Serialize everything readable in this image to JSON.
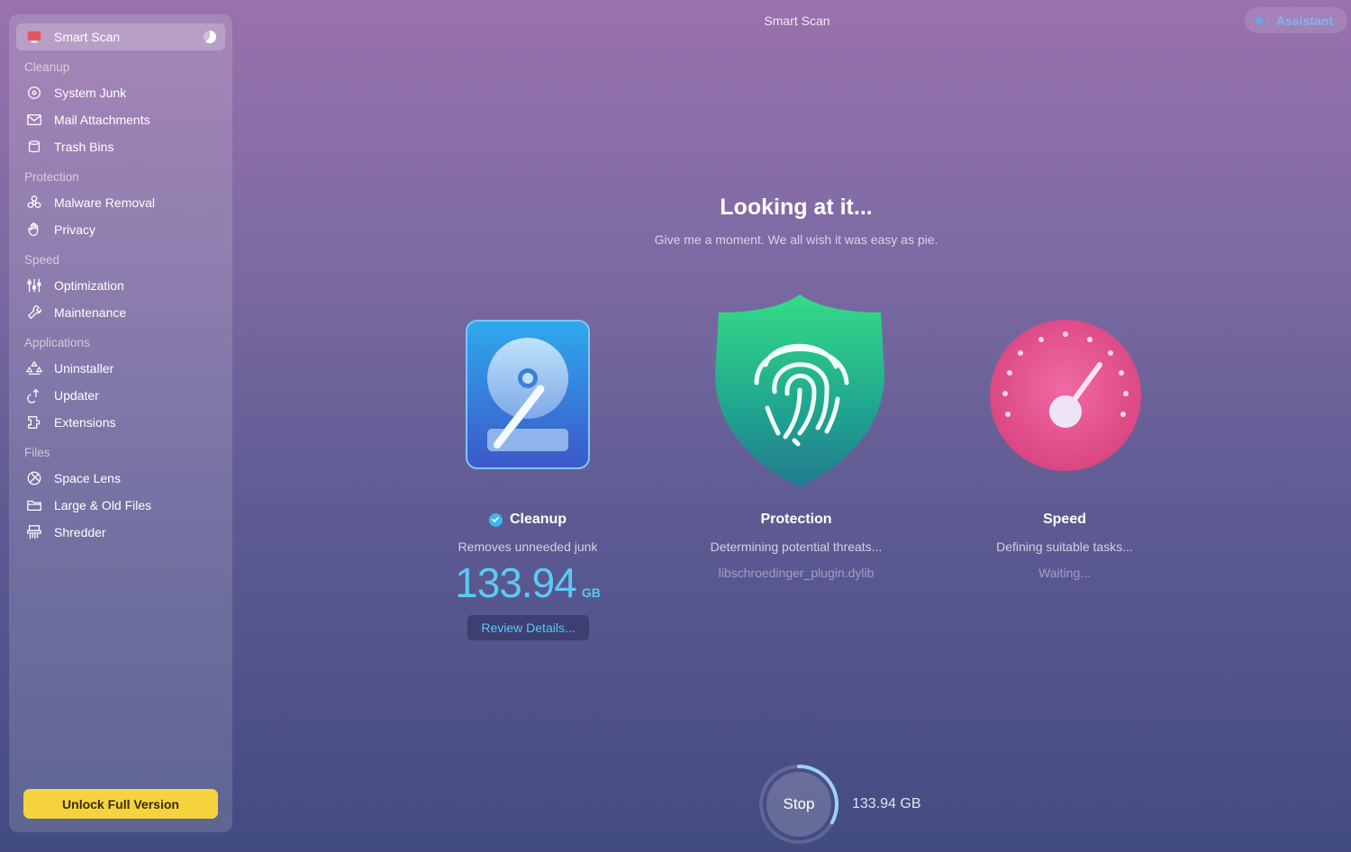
{
  "window": {
    "title": "Smart Scan"
  },
  "assistant": {
    "label": "Assistant"
  },
  "sidebar": {
    "smart_scan": "Smart Scan",
    "sections": {
      "cleanup": "Cleanup",
      "protection": "Protection",
      "speed": "Speed",
      "applications": "Applications",
      "files": "Files"
    },
    "items": {
      "system_junk": "System Junk",
      "mail_attachments": "Mail Attachments",
      "trash_bins": "Trash Bins",
      "malware_removal": "Malware Removal",
      "privacy": "Privacy",
      "optimization": "Optimization",
      "maintenance": "Maintenance",
      "uninstaller": "Uninstaller",
      "updater": "Updater",
      "extensions": "Extensions",
      "space_lens": "Space Lens",
      "large_old_files": "Large & Old Files",
      "shredder": "Shredder"
    },
    "unlock_label": "Unlock Full Version"
  },
  "main": {
    "headline": "Looking at it...",
    "subline": "Give me a moment. We all wish it was easy as pie.",
    "cleanup": {
      "title": "Cleanup",
      "description": "Removes unneeded junk",
      "size_value": "133.94",
      "size_unit": "GB",
      "review_label": "Review Details..."
    },
    "protection": {
      "title": "Protection",
      "description": "Determining potential threats...",
      "current_file": "libschroedinger_plugin.dylib"
    },
    "speed": {
      "title": "Speed",
      "description": "Defining suitable tasks...",
      "status": "Waiting..."
    },
    "stop": {
      "label": "Stop",
      "scanned_size": "133.94 GB",
      "progress": 0.33
    }
  },
  "colors": {
    "accent_blue": "#5cc9f5",
    "unlock_yellow": "#f5d33f",
    "shield_green": "#2ecf84",
    "speed_pink": "#e64d8c"
  }
}
